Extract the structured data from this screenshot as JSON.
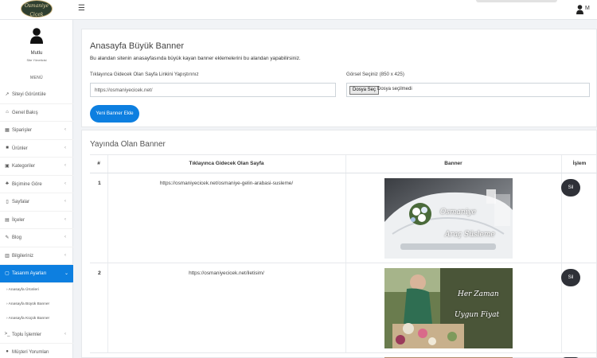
{
  "brand": {
    "logo_text_1": "Osmaniye",
    "logo_text_2": "Çiçek"
  },
  "topbar": {
    "user_name": "M"
  },
  "sidebar": {
    "profile": {
      "name": "Mutlu",
      "role": "Site Yöneticisi"
    },
    "menu_heading": "MENÜ",
    "items": [
      {
        "label": "Siteyi Görüntüle",
        "icon": "external-link-icon",
        "glyph": "↗",
        "chevron": false
      },
      {
        "label": "Genel Bakış",
        "icon": "home-icon",
        "glyph": "⌂",
        "chevron": false
      },
      {
        "label": "Siparişler",
        "icon": "orders-icon",
        "glyph": "▦",
        "chevron": true
      },
      {
        "label": "Ürünler",
        "icon": "box-icon",
        "glyph": "■",
        "chevron": true
      },
      {
        "label": "Kategoriler",
        "icon": "categories-icon",
        "glyph": "▣",
        "chevron": true
      },
      {
        "label": "Biçimine Göre",
        "icon": "shape-icon",
        "glyph": "♣",
        "chevron": true
      },
      {
        "label": "Sayfalar",
        "icon": "page-icon",
        "glyph": "▯",
        "chevron": true
      },
      {
        "label": "İlçeler",
        "icon": "map-icon",
        "glyph": "▤",
        "chevron": true
      },
      {
        "label": "Blog",
        "icon": "pen-icon",
        "glyph": "✎",
        "chevron": true
      },
      {
        "label": "Bilgileriniz",
        "icon": "info-icon",
        "glyph": "▥",
        "chevron": true
      },
      {
        "label": "Tasarım Ayarları",
        "icon": "design-icon",
        "glyph": "▢",
        "chevron": true,
        "active": true
      }
    ],
    "subitems": [
      {
        "label": "› Anasayfa Ürünleri"
      },
      {
        "label": "› Anasayfa Büyük Banner"
      },
      {
        "label": "› Anasayfa Küçük Banner"
      }
    ],
    "items_after": [
      {
        "label": "Toplu İşlemler",
        "icon": "terminal-icon",
        "glyph": ">_",
        "chevron": true
      },
      {
        "label": "Müşteri Yorumları",
        "icon": "comments-icon",
        "glyph": "●",
        "chevron": false
      }
    ]
  },
  "form": {
    "title": "Anasayfa Büyük Banner",
    "description": "Bu alandan sitenin anasayfasında büyük kayan banner eklemelerini bu alandan yapabilirsiniz.",
    "link_label": "Tıklayınca Gidecek Olan Sayfa Linkini Yapıştırınız",
    "link_value": "https://osmaniyecicek.net/",
    "image_label": "Görsel Seçiniz (850 x 425)",
    "file_button": "Dosya Seç",
    "file_status": "Dosya seçilmedi",
    "submit": "Yeni Banner Ekle"
  },
  "list": {
    "title": "Yayında Olan Banner",
    "columns": [
      "#",
      "Tıklayınca Gidecek Olan Sayfa",
      "Banner",
      "İşlem"
    ],
    "rows": [
      {
        "no": "1",
        "link": "https://osmaniyecicek.net/osmaniye-gelin-arabasi-susleme/",
        "banner_line_1": "Osmaniye",
        "banner_line_2": "Araç Süsleme",
        "delete": "Sil"
      },
      {
        "no": "2",
        "link": "https://osmaniyecicek.net/iletisim/",
        "banner_line_1": "Her Zaman",
        "banner_line_2": "Uygun Fiyat",
        "delete": "Sil"
      }
    ]
  },
  "colors": {
    "accent": "#0d7fe0",
    "dark_button": "#2f3138"
  }
}
